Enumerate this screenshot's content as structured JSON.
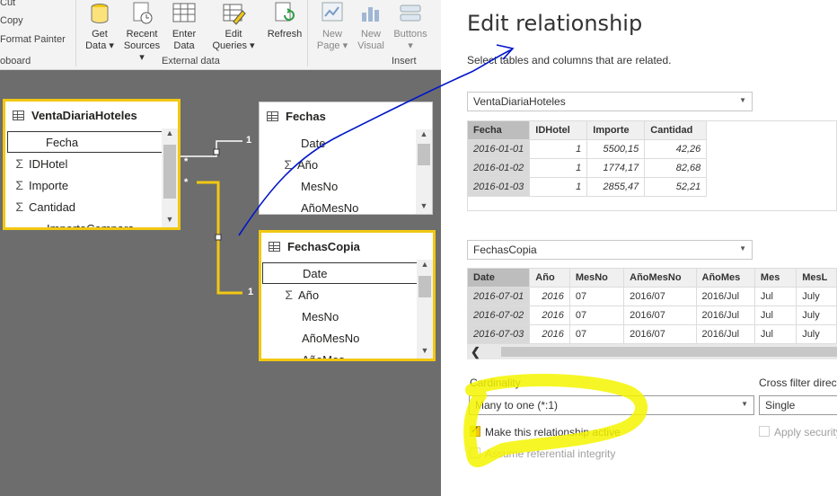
{
  "ribbon": {
    "cut": "Cut",
    "copy": "Copy",
    "format_painter": "Format Painter",
    "clipboard_group": "oboard",
    "external_group": "External data",
    "insert_group": "Insert",
    "buttons": {
      "get_data": [
        "Get",
        "Data ▾"
      ],
      "recent_sources": [
        "Recent",
        "Sources ▾"
      ],
      "enter_data": [
        "Enter",
        "Data"
      ],
      "edit_queries": [
        "Edit",
        "Queries ▾"
      ],
      "refresh": [
        "Refresh",
        ""
      ],
      "new_page": [
        "New",
        "Page ▾"
      ],
      "new_visual": [
        "New",
        "Visual"
      ],
      "buttons": [
        "Buttons",
        "▾"
      ]
    }
  },
  "canvas": {
    "tables": {
      "venta": {
        "title": "VentaDiariaHoteles",
        "fields": [
          {
            "sigma": "",
            "name": "Fecha"
          },
          {
            "sigma": "Σ",
            "name": "IDHotel"
          },
          {
            "sigma": "Σ",
            "name": "Importe"
          },
          {
            "sigma": "Σ",
            "name": "Cantidad"
          },
          {
            "sigma": "",
            "name": "ImporteCompara"
          }
        ]
      },
      "fechas": {
        "title": "Fechas",
        "fields": [
          {
            "sigma": "",
            "name": "Date"
          },
          {
            "sigma": "Σ",
            "name": "Año"
          },
          {
            "sigma": "",
            "name": "MesNo"
          },
          {
            "sigma": "",
            "name": "AñoMesNo"
          }
        ]
      },
      "fechascopia": {
        "title": "FechasCopia",
        "fields": [
          {
            "sigma": "",
            "name": "Date"
          },
          {
            "sigma": "Σ",
            "name": "Año"
          },
          {
            "sigma": "",
            "name": "MesNo"
          },
          {
            "sigma": "",
            "name": "AñoMesNo"
          },
          {
            "sigma": "",
            "name": "AñoMes"
          }
        ]
      }
    },
    "cardinality_labels": {
      "many": "*",
      "one": "1"
    }
  },
  "dialog": {
    "title": "Edit relationship",
    "subtitle": "Select tables and columns that are related.",
    "table1": {
      "selected": "VentaDiariaHoteles",
      "columns": [
        "Fecha",
        "IDHotel",
        "Importe",
        "Cantidad"
      ],
      "rows": [
        [
          "2016-01-01",
          "1",
          "5500,15",
          "42,26"
        ],
        [
          "2016-01-02",
          "1",
          "1774,17",
          "82,68"
        ],
        [
          "2016-01-03",
          "1",
          "2855,47",
          "52,21"
        ]
      ]
    },
    "table2": {
      "selected": "FechasCopia",
      "columns": [
        "Date",
        "Año",
        "MesNo",
        "AñoMesNo",
        "AñoMes",
        "Mes",
        "MesL"
      ],
      "rows": [
        [
          "2016-07-01",
          "2016",
          "07",
          "2016/07",
          "2016/Jul",
          "Jul",
          "July"
        ],
        [
          "2016-07-02",
          "2016",
          "07",
          "2016/07",
          "2016/Jul",
          "Jul",
          "July"
        ],
        [
          "2016-07-03",
          "2016",
          "07",
          "2016/07",
          "2016/Jul",
          "Jul",
          "July"
        ]
      ]
    },
    "cardinality_label": "Cardinality",
    "cardinality_value": "Many to one (*:1)",
    "cross_filter_label": "Cross filter direct",
    "cross_filter_value": "Single",
    "active_label": "Make this relationship active",
    "active_checked": true,
    "integrity_label": "Assume referential integrity",
    "integrity_checked": false,
    "security_label": "Apply security",
    "security_checked": false
  },
  "colors": {
    "highlight": "#f2c811",
    "annotation_marker": "#f5f500",
    "annotation_pen": "#0015c9",
    "canvas_bg": "#6d6d6d"
  }
}
